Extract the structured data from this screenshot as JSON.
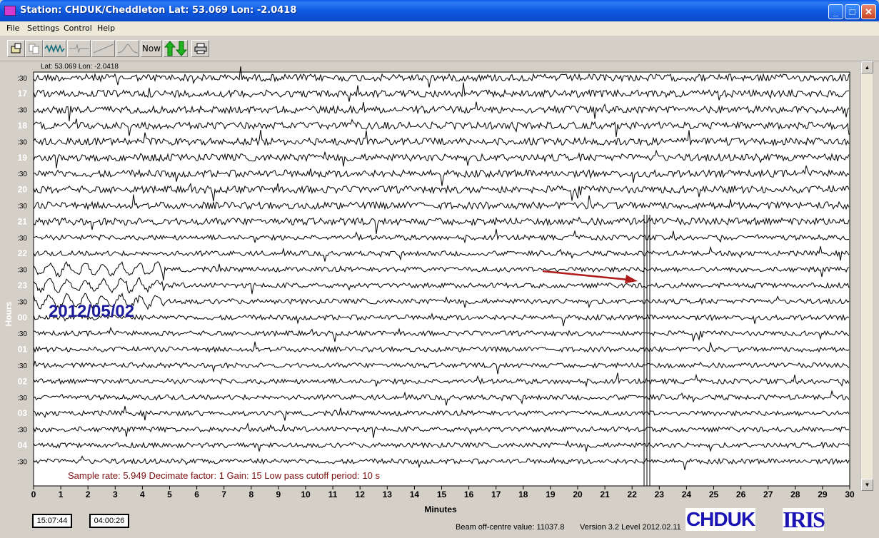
{
  "window": {
    "title": "Station: CHDUK/Cheddleton Lat: 53.069 Lon: -2.0418",
    "min_glyph": "_",
    "max_glyph": "□",
    "close_glyph": "✕"
  },
  "menu": {
    "items": [
      "File",
      "Settings",
      "Control",
      "Help"
    ]
  },
  "toolbar": {
    "buttons": [
      "open-icon",
      "copy-icon",
      "waveform-icon",
      "filter-icon",
      "ramp-icon",
      "peak-icon"
    ],
    "now_label": "Now",
    "updown_icon": "up-down-arrows-icon",
    "print_icon": "printer-icon"
  },
  "plot": {
    "lat_lon_label": "Lat: 53.069 Lon: -2.0418",
    "hours_axis_label": "Hours",
    "minutes_axis_label": "Minutes",
    "row_labels": [
      ":30",
      "17",
      ":30",
      "18",
      ":30",
      "19",
      ":30",
      "20",
      ":30",
      "21",
      ":30",
      "22",
      ":30",
      "23",
      ":30",
      "00",
      ":30",
      "01",
      ":30",
      "02",
      ":30",
      "03",
      ":30",
      "04",
      ":30"
    ],
    "x_ticks": [
      "0",
      "1",
      "2",
      "3",
      "4",
      "5",
      "6",
      "7",
      "8",
      "9",
      "10",
      "11",
      "12",
      "13",
      "14",
      "15",
      "16",
      "17",
      "18",
      "19",
      "20",
      "21",
      "22",
      "23",
      "24",
      "25",
      "26",
      "27",
      "28",
      "29",
      "30"
    ],
    "date_overlay": "2012/05/02",
    "info_line": "Sample rate: 5.949  Decimate factor: 1  Gain: 15  Low pass cutoff period: 10 s",
    "trace_color": "#000000",
    "annotation_arrow_color": "#b01c1c",
    "date_color": "#1c1c9a",
    "info_color": "#7a0d0d"
  },
  "footer": {
    "time_left": "15:07:44",
    "time_right": "04:00:26",
    "beam_value": "Beam off-centre value: 11037.8",
    "version": "Version 3.2 Level 2012.02.11",
    "logo_station": "CHDUK",
    "logo_network": "IRIS"
  }
}
